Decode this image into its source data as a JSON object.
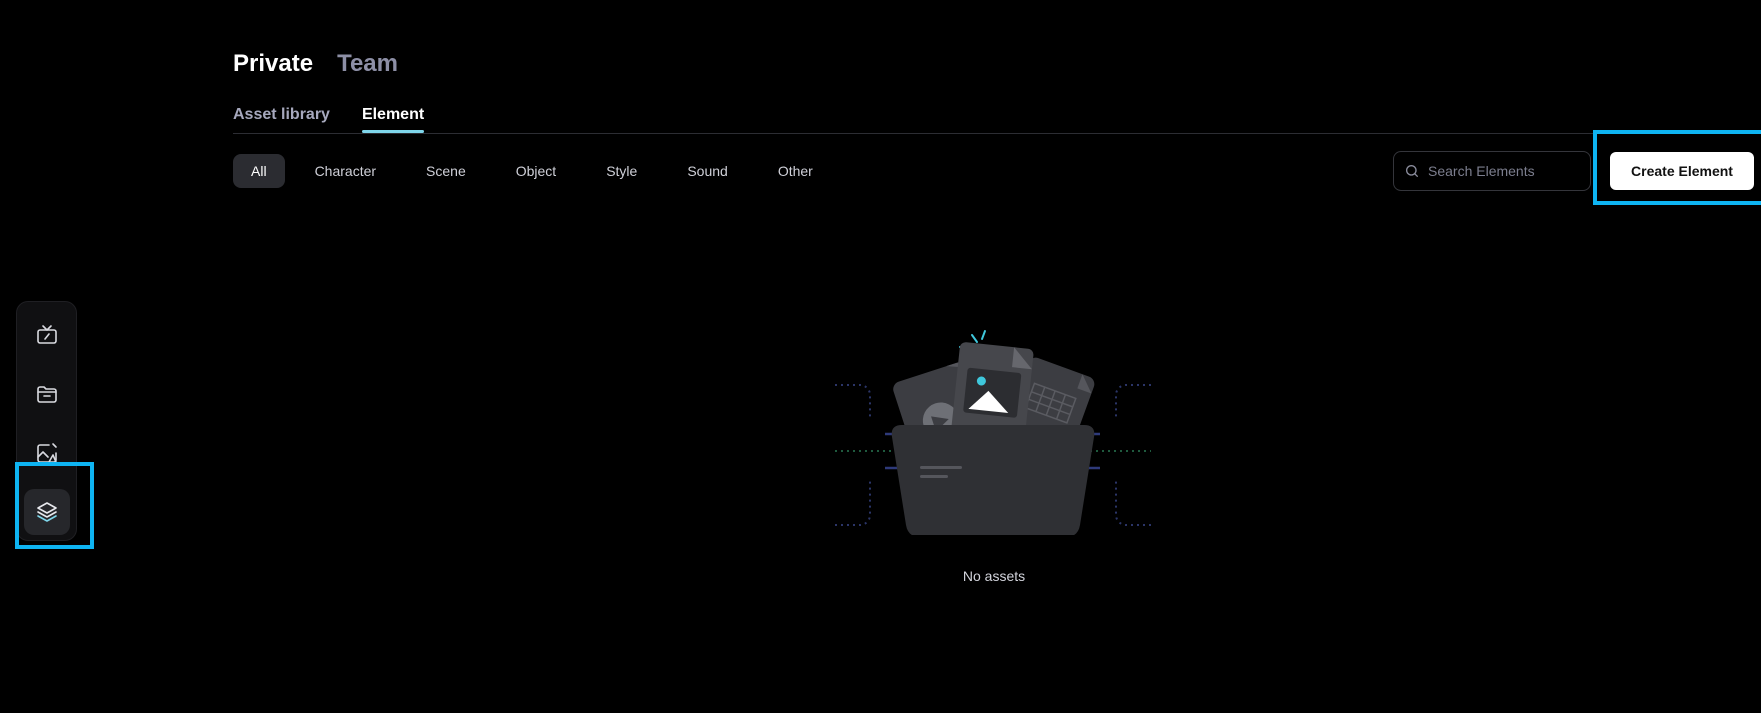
{
  "scope_tabs": [
    {
      "label": "Private",
      "active": true
    },
    {
      "label": "Team",
      "active": false
    }
  ],
  "sub_tabs": [
    {
      "label": "Asset library",
      "active": false
    },
    {
      "label": "Element",
      "active": true
    }
  ],
  "filters": [
    "All",
    "Character",
    "Scene",
    "Object",
    "Style",
    "Sound",
    "Other"
  ],
  "active_filter": "All",
  "search": {
    "placeholder": "Search Elements",
    "value": ""
  },
  "create_button": "Create Element",
  "empty_state": {
    "text": "No assets"
  },
  "sidebar": {
    "items": [
      {
        "icon": "tv-icon",
        "active": false
      },
      {
        "icon": "folder-icon",
        "active": false
      },
      {
        "icon": "image-edit-icon",
        "active": false
      },
      {
        "icon": "layers-icon",
        "active": true
      }
    ]
  },
  "colors": {
    "background": "#000000",
    "accent": "#7fd6ea",
    "highlight": "#0eb4f2",
    "chip_active": "#2b2c31"
  }
}
